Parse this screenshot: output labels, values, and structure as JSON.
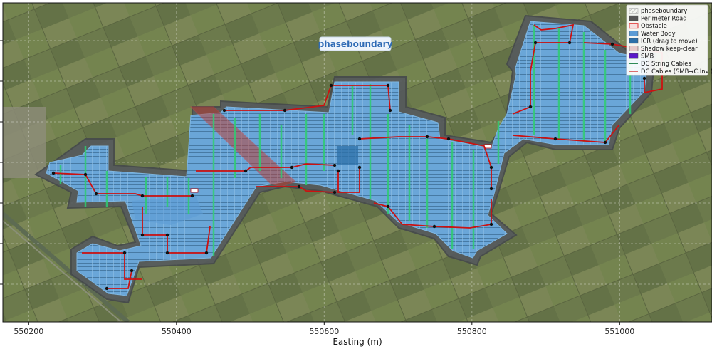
{
  "map": {
    "map_label": "phaseboundary",
    "xlabel": "Easting (m)",
    "x_ticks": [
      550200,
      550400,
      550600,
      550800,
      551000
    ],
    "x_range": [
      550165,
      551125
    ],
    "grid": true
  },
  "legend": {
    "placement": "top-right",
    "items": [
      {
        "key": "phaseboundary",
        "label": "phaseboundary",
        "swatch": "hatch",
        "color": "#d9d9d9"
      },
      {
        "key": "perimeter",
        "label": "Perimeter Road",
        "swatch": "fill",
        "color": "#555555"
      },
      {
        "key": "obstacle",
        "label": "Obstacle",
        "swatch": "outline",
        "color": "#e03030"
      },
      {
        "key": "water",
        "label": "Water Body",
        "swatch": "fill",
        "color": "#5b9bd5"
      },
      {
        "key": "icr",
        "label": "ICR (drag to move)",
        "swatch": "fill",
        "color": "#2c6fa8"
      },
      {
        "key": "shadow",
        "label": "Shadow keep-clear",
        "swatch": "fill",
        "color": "#e6c9c9"
      },
      {
        "key": "smb",
        "label": "SMB",
        "swatch": "fill",
        "color": "#5b18c9"
      },
      {
        "key": "dc_string",
        "label": "DC String Cables",
        "swatch": "line",
        "color": "#2e8b57"
      },
      {
        "key": "dc_cables",
        "label": "DC Cables (SMB→C.Inv.)",
        "swatch": "line",
        "color": "#cc1111"
      }
    ]
  },
  "colors": {
    "terrain": "#6f7d4f",
    "perimeter": "#555a5f",
    "panels": "#6aa6d8",
    "string_cables": "#2ecc71",
    "dc_cables": "#cc1111",
    "obstacle": "#c0392b"
  },
  "icons": {
    "icr_marker": "icr-block-icon",
    "smb_marker": "smb-dot-icon"
  }
}
